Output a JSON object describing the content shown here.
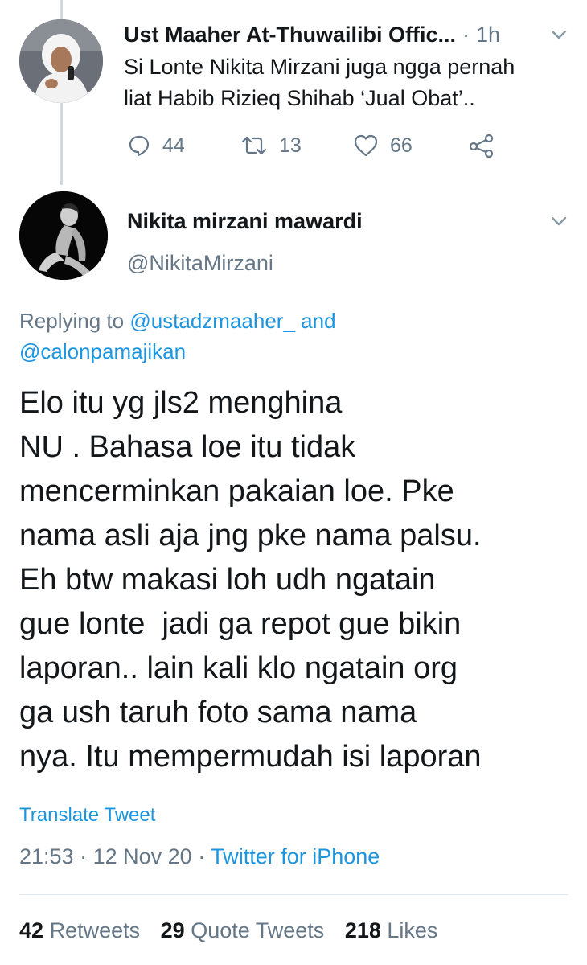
{
  "parent_tweet": {
    "author_name": "Ust Maaher At-Thuwailibi Offic...",
    "separator": "·",
    "time": "1h",
    "text_lines": [
      "Si Lonte Nikita Mirzani juga ngga pernah",
      "liat Habib Rizieq Shihab ‘Jual Obat’.."
    ],
    "actions": {
      "reply_count": "44",
      "retweet_count": "13",
      "like_count": "66"
    },
    "icons": {
      "avatar": "avatar-photo",
      "caret": "chevron-down-icon",
      "reply": "reply-icon",
      "retweet": "retweet-icon",
      "like": "heart-icon",
      "share": "share-icon"
    }
  },
  "main_tweet": {
    "author_name": "Nikita mirzani mawardi",
    "handle": "@NikitaMirzani",
    "replying_prefix": "Replying to",
    "replying_mention_1": "@ustadzmaaher_",
    "replying_and": "and",
    "replying_mention_2": "@calonpamajikan",
    "text_lines": [
      "Elo itu yg jls2 menghina",
      "NU . Bahasa loe itu tidak",
      "mencerminkan pakaian loe. Pke",
      "nama asli aja jng pke nama palsu.",
      "Eh btw makasi loh udh ngatain",
      "gue lonte  jadi ga repot gue bikin",
      "laporan.. lain kali klo ngatain org",
      "ga ush taruh foto sama nama",
      "nya. Itu mempermudah isi laporan"
    ],
    "translate_label": "Translate Tweet",
    "time": "21:53",
    "date": "12 Nov 20",
    "separator": "·",
    "client": "Twitter for iPhone",
    "stats": {
      "retweets_count": "42",
      "retweets_label": "Retweets",
      "quote_tweets_count": "29",
      "quote_tweets_label": "Quote Tweets",
      "likes_count": "218",
      "likes_label": "Likes"
    }
  },
  "colors": {
    "text_primary": "#14171a",
    "text_secondary": "#657786",
    "link": "#1b95e0",
    "divider": "#e1e8ed",
    "thread_line": "#cfd9de"
  }
}
